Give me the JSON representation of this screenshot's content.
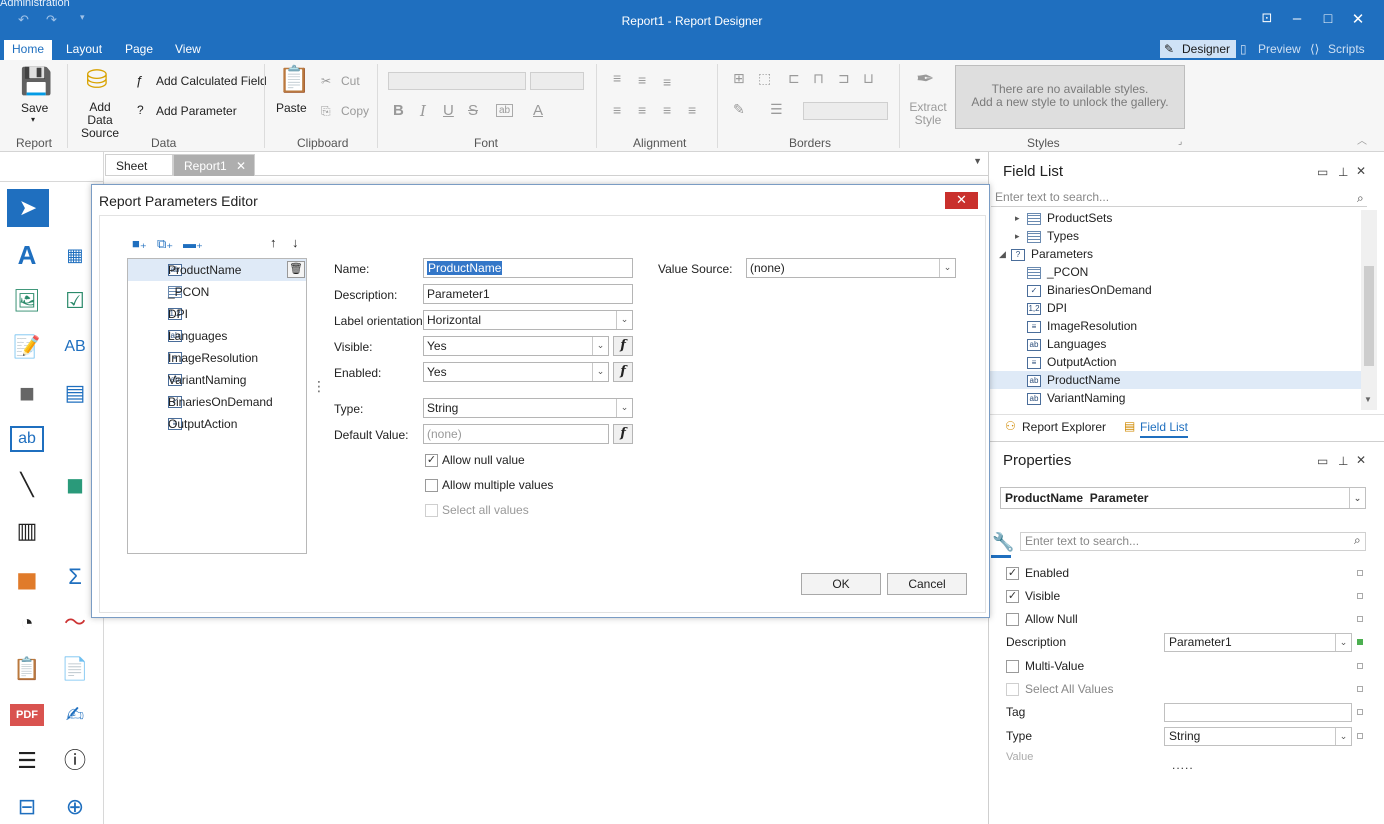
{
  "window": {
    "title": "Report1 - Report Designer",
    "behind_title": "Administration"
  },
  "ribbon_tabs": [
    "Home",
    "Layout",
    "Page",
    "View"
  ],
  "view_tabs": [
    "Designer",
    "Preview",
    "Scripts"
  ],
  "ribbon": {
    "save": "Save",
    "add_data_source": "Add Data Source",
    "add_calculated_field": "Add Calculated Field",
    "add_parameter": "Add Parameter",
    "paste": "Paste",
    "cut": "Cut",
    "copy": "Copy",
    "extract_style": "Extract Style",
    "styles_msg_1": "There are no available styles.",
    "styles_msg_2": "Add a new style to unlock the gallery.",
    "groups": {
      "report": "Report",
      "data": "Data",
      "clipboard": "Clipboard",
      "font": "Font",
      "alignment": "Alignment",
      "borders": "Borders",
      "styles": "Styles"
    }
  },
  "doc_tabs": [
    "Sheet",
    "Report1"
  ],
  "field_list": {
    "title": "Field List",
    "search_placeholder": "Enter text to search...",
    "items": [
      {
        "label": "ProductSets",
        "icon": "table",
        "level": 1,
        "expander": "collapsed"
      },
      {
        "label": "Types",
        "icon": "table",
        "level": 1,
        "expander": "collapsed"
      },
      {
        "label": "Parameters",
        "icon": "question",
        "level": 0,
        "expander": "expanded"
      },
      {
        "label": "_PCON",
        "icon": "table",
        "level": 1
      },
      {
        "label": "BinariesOnDemand",
        "icon": "check",
        "level": 1
      },
      {
        "label": "DPI",
        "icon": "number",
        "level": 1
      },
      {
        "label": "ImageResolution",
        "icon": "list",
        "level": 1
      },
      {
        "label": "Languages",
        "icon": "text",
        "level": 1
      },
      {
        "label": "OutputAction",
        "icon": "list",
        "level": 1
      },
      {
        "label": "ProductName",
        "icon": "text",
        "level": 1,
        "selected": true
      },
      {
        "label": "VariantNaming",
        "icon": "text",
        "level": 1
      }
    ],
    "bottom_tabs": [
      "Report Explorer",
      "Field List"
    ]
  },
  "properties": {
    "title": "Properties",
    "object_name": "ProductName",
    "object_type": "Parameter",
    "search_placeholder": "Enter text to search...",
    "rows": {
      "enabled": "Enabled",
      "visible": "Visible",
      "allow_null": "Allow Null",
      "description": "Description",
      "description_value": "Parameter1",
      "multi_value": "Multi-Value",
      "select_all_values": "Select All Values",
      "tag": "Tag",
      "type": "Type",
      "type_value": "String",
      "value": "Value"
    },
    "checks": {
      "enabled": true,
      "visible": true,
      "allow_null": false,
      "multi_value": false,
      "select_all_values": false
    },
    "more": "....."
  },
  "dialog": {
    "title": "Report Parameters Editor",
    "close": "✕",
    "parameters": [
      {
        "label": "ProductName",
        "icon": "text",
        "selected": true
      },
      {
        "label": "_PCON",
        "icon": "table"
      },
      {
        "label": "DPI",
        "icon": "number"
      },
      {
        "label": "Languages",
        "icon": "text"
      },
      {
        "label": "ImageResolution",
        "icon": "list"
      },
      {
        "label": "VariantNaming",
        "icon": "text"
      },
      {
        "label": "BinariesOnDemand",
        "icon": "check"
      },
      {
        "label": "OutputAction",
        "icon": "list"
      }
    ],
    "fields": {
      "name_label": "Name:",
      "name_value": "ProductName",
      "description_label": "Description:",
      "description_value": "Parameter1",
      "label_orientation_label": "Label orientation:",
      "label_orientation_value": "Horizontal",
      "visible_label": "Visible:",
      "visible_value": "Yes",
      "enabled_label": "Enabled:",
      "enabled_value": "Yes",
      "type_label": "Type:",
      "type_value": "String",
      "default_value_label": "Default Value:",
      "default_value_value": "(none)",
      "value_source_label": "Value Source:",
      "value_source_value": "(none)"
    },
    "checkboxes": {
      "allow_null": "Allow null value",
      "allow_multiple": "Allow multiple values",
      "select_all": "Select all values"
    },
    "checkbox_states": {
      "allow_null": true,
      "allow_multiple": false,
      "select_all": false
    },
    "ok": "OK",
    "cancel": "Cancel"
  },
  "colors": {
    "accent": "#1f6fbf",
    "close_red": "#c9302c",
    "selection": "#dfeaf7"
  }
}
